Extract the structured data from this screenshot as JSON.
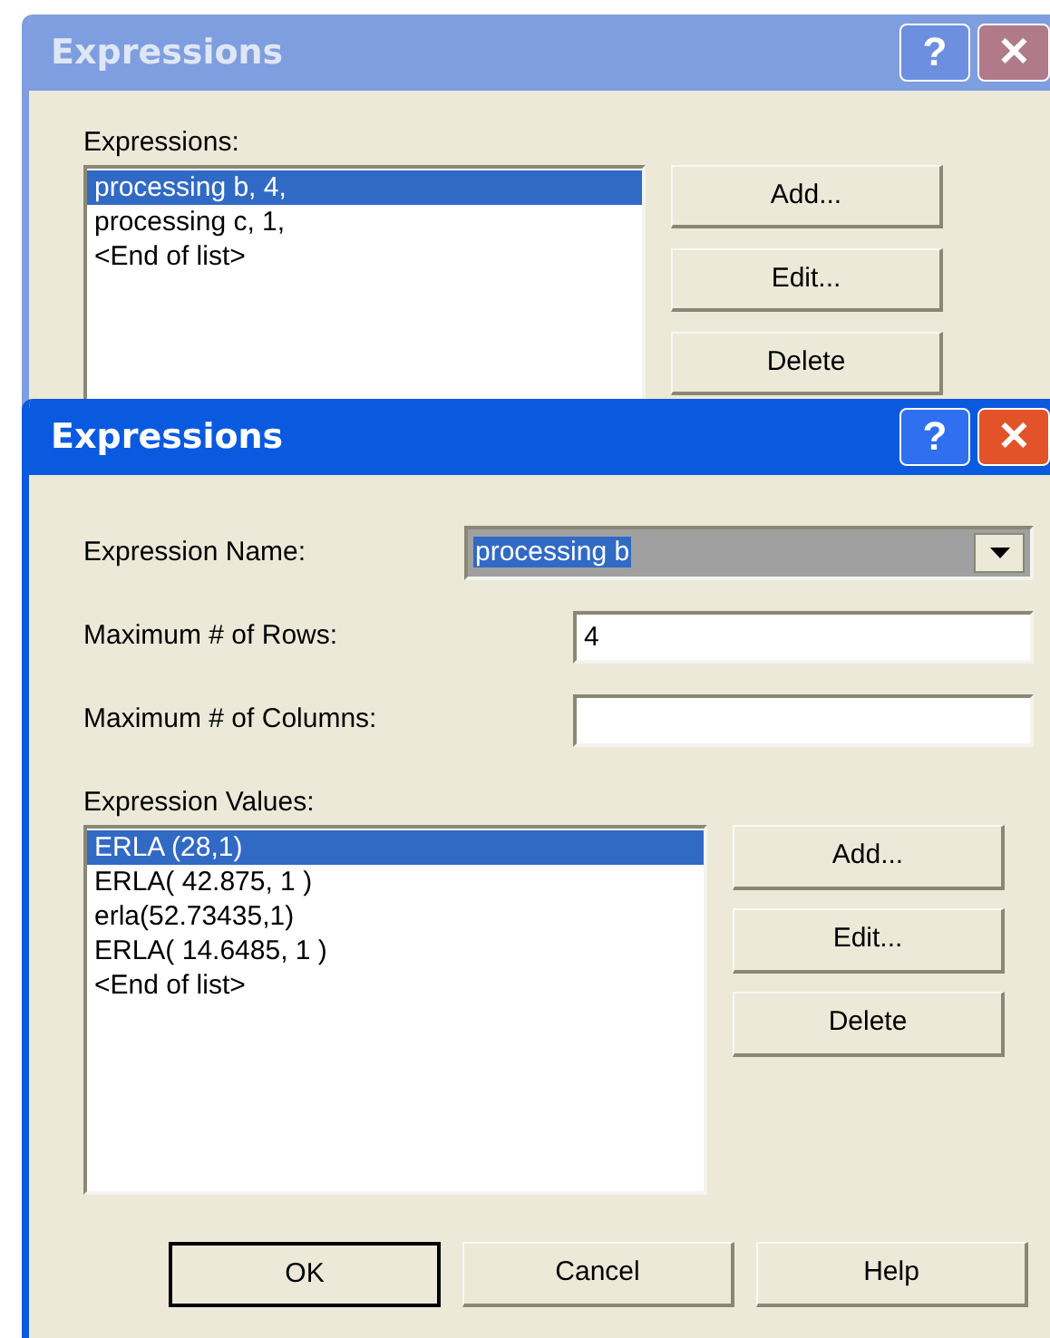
{
  "back_dialog": {
    "title": "Expressions",
    "active": false,
    "help_button": "?",
    "close_button": "✕",
    "list_label": "Expressions:",
    "items": [
      {
        "text": "processing b, 4,",
        "selected": true
      },
      {
        "text": "processing c, 1,",
        "selected": false
      },
      {
        "text": "<End of list>",
        "selected": false
      }
    ],
    "buttons": [
      "Add...",
      "Edit...",
      "Delete"
    ]
  },
  "front_dialog": {
    "title": "Expressions",
    "active": true,
    "help_button": "?",
    "close_button": "✕",
    "fields": [
      {
        "kind": "combo",
        "label": "Expression Name:",
        "value": "processing b"
      },
      {
        "kind": "text",
        "label": "Maximum # of Rows:",
        "value": "4"
      },
      {
        "kind": "text",
        "label": "Maximum # of Columns:"
      }
    ],
    "list_label": "Expression Values:",
    "items": [
      {
        "text": "ERLA (28,1)",
        "selected": true
      },
      {
        "text": "ERLA( 42.875, 1 )",
        "selected": false
      },
      {
        "text": "erla(52.73435,1)",
        "selected": false
      },
      {
        "text": "ERLA( 14.6485, 1 )",
        "selected": false
      },
      {
        "text": "<End of list>",
        "selected": false
      }
    ],
    "buttons": [
      "Add...",
      "Edit...",
      "Delete"
    ],
    "footer_buttons": [
      {
        "label": "OK",
        "default": true
      },
      {
        "label": "Cancel",
        "default": false
      },
      {
        "label": "Help",
        "default": false
      }
    ]
  }
}
